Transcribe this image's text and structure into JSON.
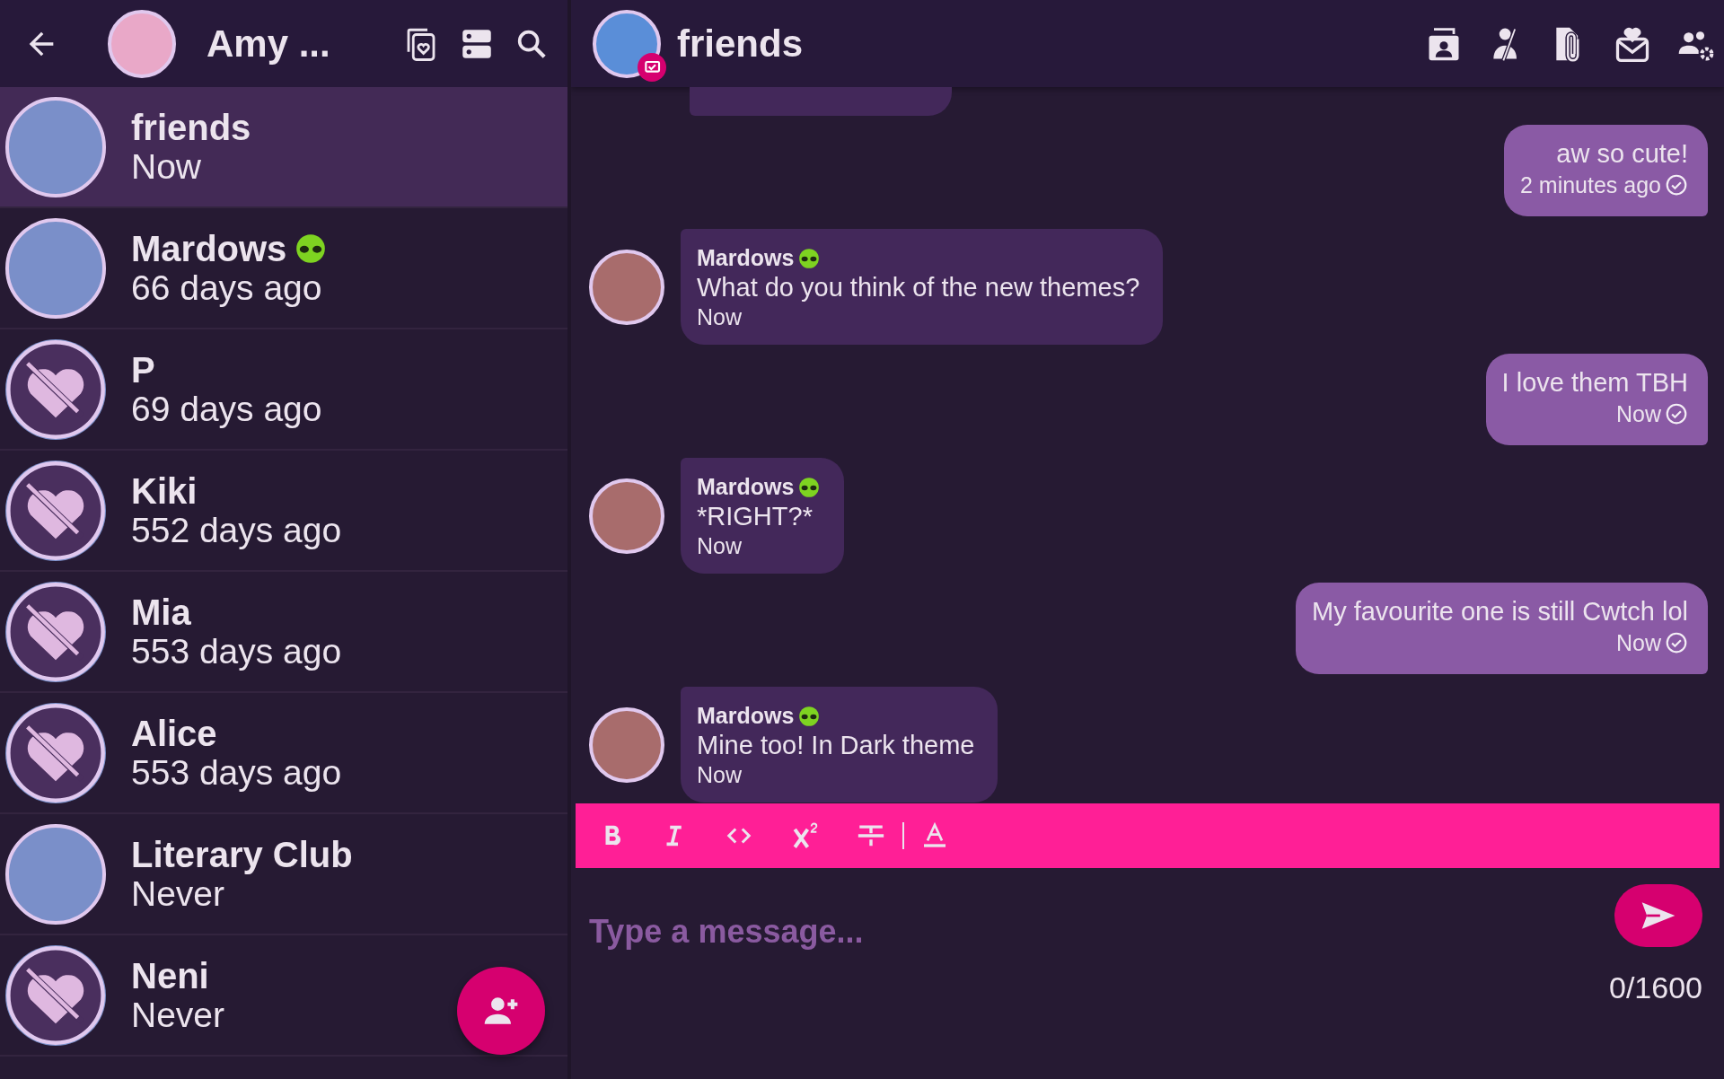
{
  "sidebar": {
    "header": {
      "title": "Amy ..."
    },
    "chats": [
      {
        "name": "friends",
        "time": "Now",
        "kind": "photo",
        "badge": false,
        "selected": true
      },
      {
        "name": "Mardows",
        "time": "66 days ago",
        "kind": "photo",
        "badge": true,
        "selected": false
      },
      {
        "name": "P",
        "time": "69 days ago",
        "kind": "placeholder",
        "badge": false,
        "selected": false
      },
      {
        "name": "Kiki",
        "time": "552 days ago",
        "kind": "placeholder",
        "badge": false,
        "selected": false
      },
      {
        "name": "Mia",
        "time": "553 days ago",
        "kind": "placeholder",
        "badge": false,
        "selected": false
      },
      {
        "name": "Alice",
        "time": "553 days ago",
        "kind": "placeholder",
        "badge": false,
        "selected": false
      },
      {
        "name": "Literary Club",
        "time": "Never",
        "kind": "photo",
        "badge": false,
        "selected": false
      },
      {
        "name": "Neni",
        "time": "Never",
        "kind": "placeholder",
        "badge": false,
        "selected": false
      }
    ]
  },
  "chat": {
    "header": {
      "title": "friends"
    },
    "messages": [
      {
        "kind": "sent",
        "text": "aw so cute!",
        "time": "2 minutes ago",
        "read": true
      },
      {
        "kind": "received",
        "sender": "Mardows",
        "badge": true,
        "text": "What do you think of the new themes?",
        "time": "Now"
      },
      {
        "kind": "sent",
        "text": "I love them TBH",
        "time": "Now",
        "read": true
      },
      {
        "kind": "received",
        "sender": "Mardows",
        "badge": true,
        "text": "*RIGHT?*",
        "time": "Now"
      },
      {
        "kind": "sent",
        "text": "My favourite one is still Cwtch lol",
        "time": "Now",
        "read": true
      },
      {
        "kind": "received",
        "sender": "Mardows",
        "badge": true,
        "text": "Mine too! In Dark theme",
        "time": "Now"
      }
    ]
  },
  "composer": {
    "toolbar": [
      {
        "kind": "bold"
      },
      {
        "kind": "italic"
      },
      {
        "kind": "code"
      },
      {
        "kind": "superscript"
      },
      {
        "kind": "strikethrough"
      },
      {
        "kind": "divider"
      },
      {
        "kind": "text_color"
      }
    ],
    "placeholder": "Type a message...",
    "counter": "0/1600"
  }
}
